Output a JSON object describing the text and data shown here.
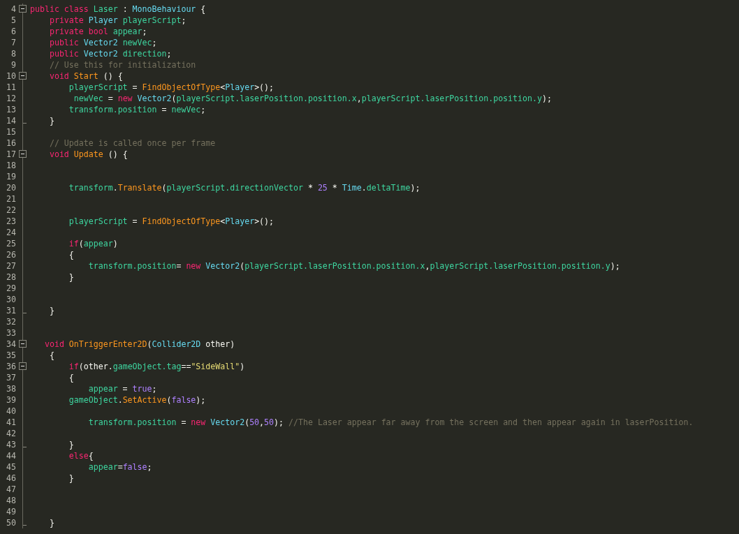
{
  "editor": {
    "lines": [
      {
        "number": "4",
        "collapsible": true,
        "tokens": [
          {
            "text": "public class ",
            "kind": "keyword"
          },
          {
            "text": "Laser",
            "kind": "ident"
          },
          {
            "text": " : ",
            "kind": "plain"
          },
          {
            "text": "MonoBehaviour",
            "kind": "type"
          },
          {
            "text": " {",
            "kind": "plain"
          }
        ]
      },
      {
        "number": "5",
        "tokens": [
          {
            "text": "    private ",
            "kind": "keyword"
          },
          {
            "text": "Player ",
            "kind": "type"
          },
          {
            "text": "playerScript",
            "kind": "ident"
          },
          {
            "text": ";",
            "kind": "plain"
          }
        ]
      },
      {
        "number": "6",
        "tokens": [
          {
            "text": "    private bool ",
            "kind": "keyword"
          },
          {
            "text": "appear",
            "kind": "ident"
          },
          {
            "text": ";",
            "kind": "plain"
          }
        ]
      },
      {
        "number": "7",
        "tokens": [
          {
            "text": "    public ",
            "kind": "keyword"
          },
          {
            "text": "Vector2 ",
            "kind": "type"
          },
          {
            "text": "newVec",
            "kind": "ident"
          },
          {
            "text": ";",
            "kind": "plain"
          }
        ]
      },
      {
        "number": "8",
        "tokens": [
          {
            "text": "    public ",
            "kind": "keyword"
          },
          {
            "text": "Vector2 ",
            "kind": "type"
          },
          {
            "text": "direction",
            "kind": "ident"
          },
          {
            "text": ";",
            "kind": "plain"
          }
        ]
      },
      {
        "number": "9",
        "tokens": [
          {
            "text": "    // Use this for initialization",
            "kind": "comment"
          }
        ]
      },
      {
        "number": "10",
        "collapsible": true,
        "tokens": [
          {
            "text": "    void ",
            "kind": "keyword"
          },
          {
            "text": "Start",
            "kind": "method"
          },
          {
            "text": " () {",
            "kind": "plain"
          }
        ]
      },
      {
        "number": "11",
        "tokens": [
          {
            "text": "        playerScript",
            "kind": "ident"
          },
          {
            "text": " = ",
            "kind": "plain"
          },
          {
            "text": "FindObjectOfType",
            "kind": "method"
          },
          {
            "text": "<",
            "kind": "plain"
          },
          {
            "text": "Player",
            "kind": "type"
          },
          {
            "text": ">();",
            "kind": "plain"
          }
        ]
      },
      {
        "number": "12",
        "tokens": [
          {
            "text": "         newVec",
            "kind": "ident"
          },
          {
            "text": " = ",
            "kind": "plain"
          },
          {
            "text": "new ",
            "kind": "keyword"
          },
          {
            "text": "Vector2",
            "kind": "type"
          },
          {
            "text": "(",
            "kind": "plain"
          },
          {
            "text": "playerScript.laserPosition.position.x",
            "kind": "ident"
          },
          {
            "text": ",",
            "kind": "plain"
          },
          {
            "text": "playerScript.laserPosition.position.y",
            "kind": "ident"
          },
          {
            "text": ");",
            "kind": "plain"
          }
        ]
      },
      {
        "number": "13",
        "tokens": [
          {
            "text": "        transform.position",
            "kind": "ident"
          },
          {
            "text": " = ",
            "kind": "plain"
          },
          {
            "text": "newVec",
            "kind": "ident"
          },
          {
            "text": ";",
            "kind": "plain"
          }
        ]
      },
      {
        "number": "14",
        "block_end": true,
        "tokens": [
          {
            "text": "    }",
            "kind": "plain"
          }
        ]
      },
      {
        "number": "15"
      },
      {
        "number": "16",
        "tokens": [
          {
            "text": "    // Update is called once per frame",
            "kind": "comment"
          }
        ]
      },
      {
        "number": "17",
        "collapsible": true,
        "tokens": [
          {
            "text": "    void ",
            "kind": "keyword"
          },
          {
            "text": "Update",
            "kind": "method"
          },
          {
            "text": " () {",
            "kind": "plain"
          }
        ]
      },
      {
        "number": "18"
      },
      {
        "number": "19"
      },
      {
        "number": "20",
        "tokens": [
          {
            "text": "        transform",
            "kind": "ident"
          },
          {
            "text": ".",
            "kind": "plain"
          },
          {
            "text": "Translate",
            "kind": "method"
          },
          {
            "text": "(",
            "kind": "plain"
          },
          {
            "text": "playerScript.directionVector",
            "kind": "ident"
          },
          {
            "text": " * ",
            "kind": "plain"
          },
          {
            "text": "25",
            "kind": "number"
          },
          {
            "text": " * ",
            "kind": "plain"
          },
          {
            "text": "Time",
            "kind": "type"
          },
          {
            "text": ".",
            "kind": "plain"
          },
          {
            "text": "deltaTime",
            "kind": "ident"
          },
          {
            "text": ");",
            "kind": "plain"
          }
        ]
      },
      {
        "number": "21"
      },
      {
        "number": "22"
      },
      {
        "number": "23",
        "tokens": [
          {
            "text": "        playerScript",
            "kind": "ident"
          },
          {
            "text": " = ",
            "kind": "plain"
          },
          {
            "text": "FindObjectOfType",
            "kind": "method"
          },
          {
            "text": "<",
            "kind": "plain"
          },
          {
            "text": "Player",
            "kind": "type"
          },
          {
            "text": ">();",
            "kind": "plain"
          }
        ]
      },
      {
        "number": "24"
      },
      {
        "number": "25",
        "tokens": [
          {
            "text": "        if",
            "kind": "keyword"
          },
          {
            "text": "(",
            "kind": "plain"
          },
          {
            "text": "appear",
            "kind": "ident"
          },
          {
            "text": ")",
            "kind": "plain"
          }
        ]
      },
      {
        "number": "26",
        "tokens": [
          {
            "text": "        {",
            "kind": "plain"
          }
        ]
      },
      {
        "number": "27",
        "tokens": [
          {
            "text": "            transform.position",
            "kind": "ident"
          },
          {
            "text": "= ",
            "kind": "plain"
          },
          {
            "text": "new ",
            "kind": "keyword"
          },
          {
            "text": "Vector2",
            "kind": "type"
          },
          {
            "text": "(",
            "kind": "plain"
          },
          {
            "text": "playerScript.laserPosition.position.x",
            "kind": "ident"
          },
          {
            "text": ",",
            "kind": "plain"
          },
          {
            "text": "playerScript.laserPosition.position.y",
            "kind": "ident"
          },
          {
            "text": ");",
            "kind": "plain"
          }
        ]
      },
      {
        "number": "28",
        "tokens": [
          {
            "text": "        }",
            "kind": "plain"
          }
        ]
      },
      {
        "number": "29"
      },
      {
        "number": "30"
      },
      {
        "number": "31",
        "block_end": true,
        "tokens": [
          {
            "text": "    }",
            "kind": "plain"
          }
        ]
      },
      {
        "number": "32"
      },
      {
        "number": "33"
      },
      {
        "number": "34",
        "collapsible": true,
        "tokens": [
          {
            "text": "   void ",
            "kind": "keyword"
          },
          {
            "text": "OnTriggerEnter2D",
            "kind": "method"
          },
          {
            "text": "(",
            "kind": "plain"
          },
          {
            "text": "Collider2D",
            "kind": "type"
          },
          {
            "text": " other)",
            "kind": "plain"
          }
        ]
      },
      {
        "number": "35",
        "tokens": [
          {
            "text": "    {",
            "kind": "plain"
          }
        ]
      },
      {
        "number": "36",
        "collapsible": true,
        "tokens": [
          {
            "text": "        if",
            "kind": "keyword"
          },
          {
            "text": "(other.",
            "kind": "plain"
          },
          {
            "text": "gameObject.tag",
            "kind": "ident"
          },
          {
            "text": "==",
            "kind": "plain"
          },
          {
            "text": "\"SideWall\"",
            "kind": "string"
          },
          {
            "text": ")",
            "kind": "plain"
          }
        ]
      },
      {
        "number": "37",
        "tokens": [
          {
            "text": "        {",
            "kind": "plain"
          }
        ]
      },
      {
        "number": "38",
        "tokens": [
          {
            "text": "            appear",
            "kind": "ident"
          },
          {
            "text": " = ",
            "kind": "plain"
          },
          {
            "text": "true",
            "kind": "number"
          },
          {
            "text": ";",
            "kind": "plain"
          }
        ]
      },
      {
        "number": "39",
        "tokens": [
          {
            "text": "        gameObject",
            "kind": "ident"
          },
          {
            "text": ".",
            "kind": "plain"
          },
          {
            "text": "SetActive",
            "kind": "method"
          },
          {
            "text": "(",
            "kind": "plain"
          },
          {
            "text": "false",
            "kind": "number"
          },
          {
            "text": ");",
            "kind": "plain"
          }
        ]
      },
      {
        "number": "40"
      },
      {
        "number": "41",
        "tokens": [
          {
            "text": "            transform.position",
            "kind": "ident"
          },
          {
            "text": " = ",
            "kind": "plain"
          },
          {
            "text": "new ",
            "kind": "keyword"
          },
          {
            "text": "Vector2",
            "kind": "type"
          },
          {
            "text": "(",
            "kind": "plain"
          },
          {
            "text": "50",
            "kind": "number"
          },
          {
            "text": ",",
            "kind": "plain"
          },
          {
            "text": "50",
            "kind": "number"
          },
          {
            "text": "); ",
            "kind": "plain"
          },
          {
            "text": "//The Laser appear far away from the screen and then appear again in laserPosition.",
            "kind": "comment"
          }
        ]
      },
      {
        "number": "42"
      },
      {
        "number": "43",
        "block_end": true,
        "tokens": [
          {
            "text": "        }",
            "kind": "plain"
          }
        ]
      },
      {
        "number": "44",
        "tokens": [
          {
            "text": "        else",
            "kind": "keyword"
          },
          {
            "text": "{",
            "kind": "plain"
          }
        ]
      },
      {
        "number": "45",
        "tokens": [
          {
            "text": "            appear",
            "kind": "ident"
          },
          {
            "text": "=",
            "kind": "plain"
          },
          {
            "text": "false",
            "kind": "number"
          },
          {
            "text": ";",
            "kind": "plain"
          }
        ]
      },
      {
        "number": "46",
        "tokens": [
          {
            "text": "        }",
            "kind": "plain"
          }
        ]
      },
      {
        "number": "47"
      },
      {
        "number": "48"
      },
      {
        "number": "49"
      },
      {
        "number": "50",
        "block_end": true,
        "tokens": [
          {
            "text": "    }",
            "kind": "plain"
          }
        ]
      }
    ]
  }
}
